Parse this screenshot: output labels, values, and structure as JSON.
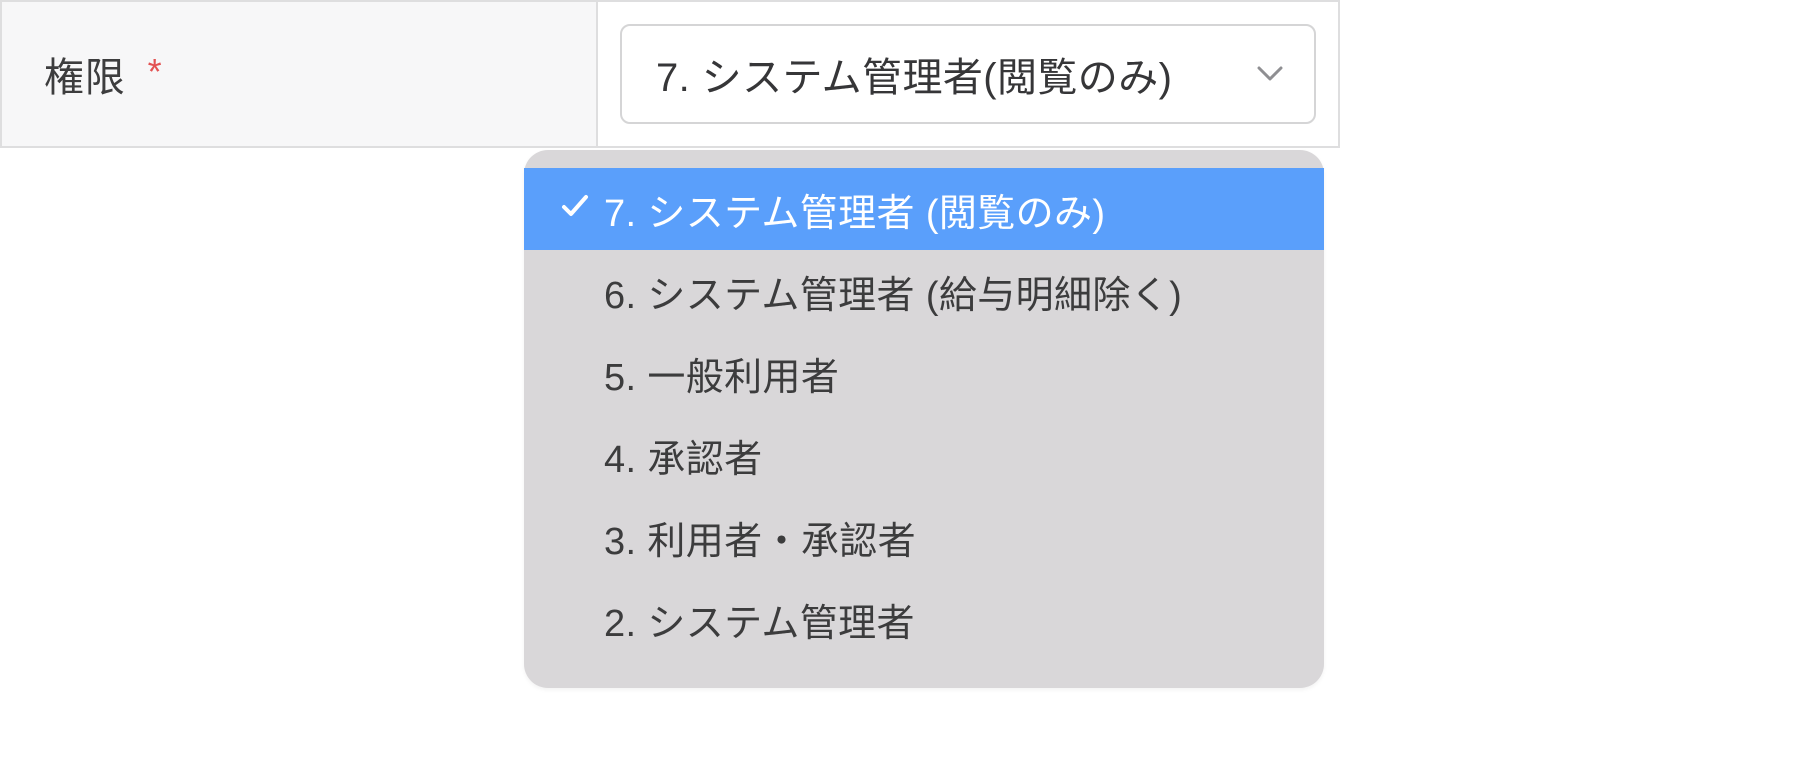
{
  "field": {
    "label": "権限",
    "required_mark": "*",
    "selected_value": "7. システム管理者(閲覧のみ)"
  },
  "dropdown": {
    "options": [
      {
        "label": "7. システム管理者 (閲覧のみ)",
        "selected": true
      },
      {
        "label": "6. システム管理者 (給与明細除く)",
        "selected": false
      },
      {
        "label": "5. 一般利用者",
        "selected": false
      },
      {
        "label": "4. 承認者",
        "selected": false
      },
      {
        "label": "3. 利用者・承認者",
        "selected": false
      },
      {
        "label": "2. システム管理者",
        "selected": false
      }
    ]
  }
}
